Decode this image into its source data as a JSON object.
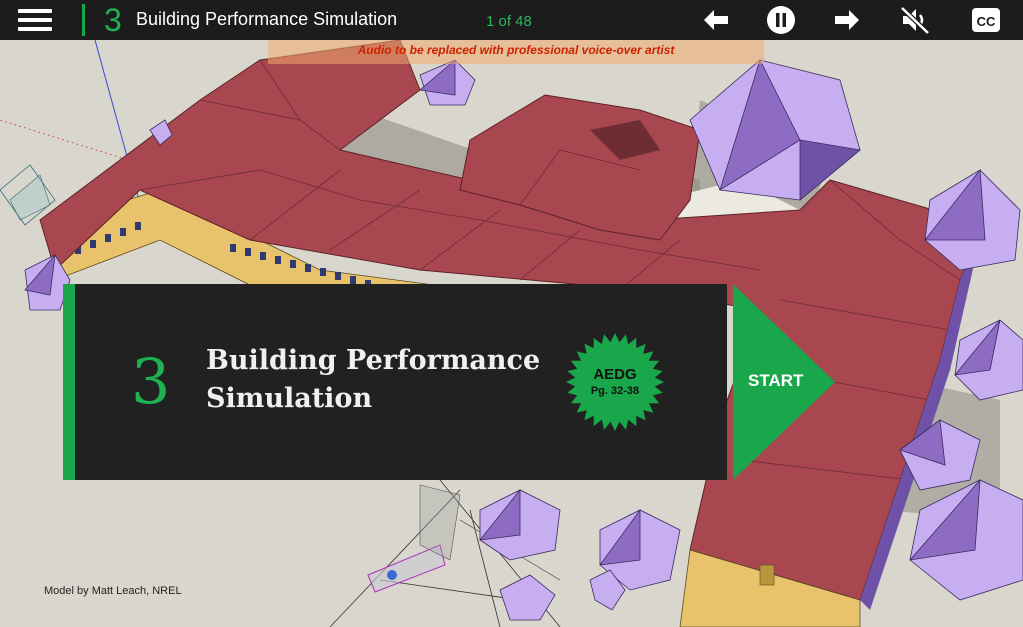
{
  "topbar": {
    "chapter_number": "3",
    "title": "Building Performance Simulation",
    "slide_counter": "1 of 48",
    "icons": [
      "menu-icon",
      "back-arrow-icon",
      "pause-icon",
      "forward-arrow-icon",
      "mute-icon",
      "closed-captions-icon"
    ]
  },
  "notice": "Audio to be replaced with professional voice-over artist",
  "card": {
    "number": "3",
    "title": "Building Performance Simulation",
    "badge_title": "AEDG",
    "badge_pages": "Pg. 32-38",
    "start_label": "START"
  },
  "credit": "Model by Matt Leach, NREL",
  "colors": {
    "accent_green": "#1aa64a",
    "roof_red": "#a8474f",
    "wall_yellow": "#e8c36b",
    "tree_purple": "#8e6cc4",
    "card_bg": "#212121"
  }
}
